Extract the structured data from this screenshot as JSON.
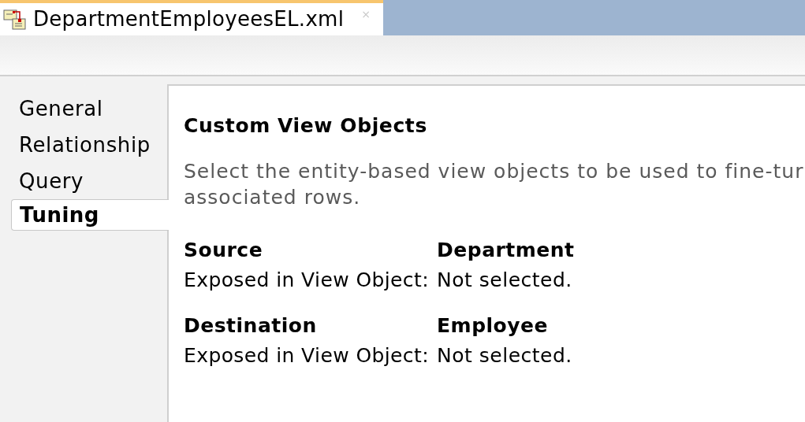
{
  "editor_tab": {
    "title": "DepartmentEmployeesEL.xml",
    "close": "×"
  },
  "nav": [
    {
      "label": "General",
      "selected": false
    },
    {
      "label": "Relationship",
      "selected": false
    },
    {
      "label": "Query",
      "selected": false
    },
    {
      "label": "Tuning",
      "selected": true
    }
  ],
  "panel": {
    "heading": "Custom View Objects",
    "description_lines": [
      "Select the entity-based view objects to be used to fine-tur",
      "associated rows."
    ],
    "sections": [
      {
        "title": "Source",
        "entity": "Department",
        "field_label": "Exposed in View Object:",
        "field_value": "Not selected."
      },
      {
        "title": "Destination",
        "entity": "Employee",
        "field_label": "Exposed in View Object:",
        "field_value": "Not selected."
      }
    ]
  }
}
